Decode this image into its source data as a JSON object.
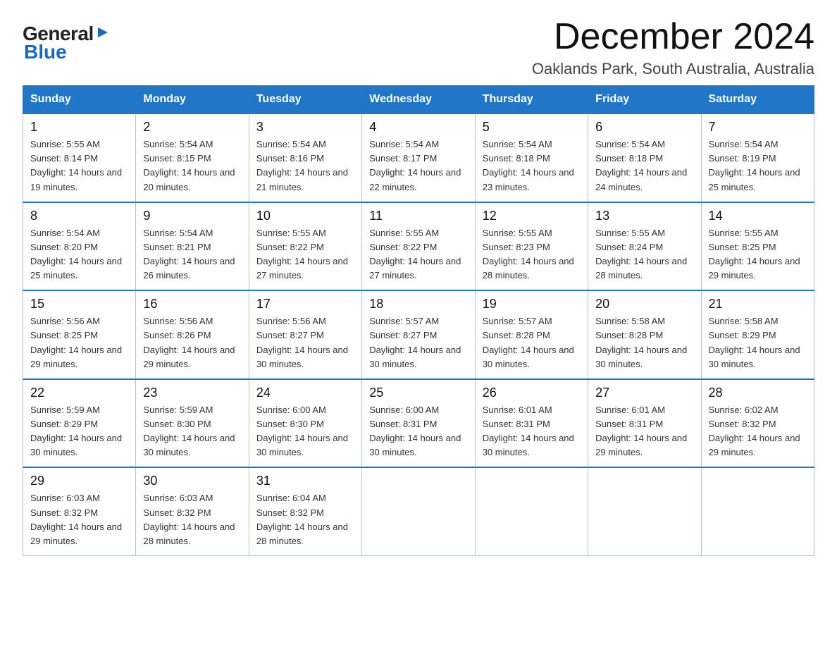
{
  "header": {
    "logo_general": "General",
    "logo_blue": "Blue",
    "month_title": "December 2024",
    "location": "Oaklands Park, South Australia, Australia"
  },
  "weekdays": [
    "Sunday",
    "Monday",
    "Tuesday",
    "Wednesday",
    "Thursday",
    "Friday",
    "Saturday"
  ],
  "weeks": [
    [
      {
        "day": "1",
        "sunrise": "5:55 AM",
        "sunset": "8:14 PM",
        "daylight": "14 hours and 19 minutes."
      },
      {
        "day": "2",
        "sunrise": "5:54 AM",
        "sunset": "8:15 PM",
        "daylight": "14 hours and 20 minutes."
      },
      {
        "day": "3",
        "sunrise": "5:54 AM",
        "sunset": "8:16 PM",
        "daylight": "14 hours and 21 minutes."
      },
      {
        "day": "4",
        "sunrise": "5:54 AM",
        "sunset": "8:17 PM",
        "daylight": "14 hours and 22 minutes."
      },
      {
        "day": "5",
        "sunrise": "5:54 AM",
        "sunset": "8:18 PM",
        "daylight": "14 hours and 23 minutes."
      },
      {
        "day": "6",
        "sunrise": "5:54 AM",
        "sunset": "8:18 PM",
        "daylight": "14 hours and 24 minutes."
      },
      {
        "day": "7",
        "sunrise": "5:54 AM",
        "sunset": "8:19 PM",
        "daylight": "14 hours and 25 minutes."
      }
    ],
    [
      {
        "day": "8",
        "sunrise": "5:54 AM",
        "sunset": "8:20 PM",
        "daylight": "14 hours and 25 minutes."
      },
      {
        "day": "9",
        "sunrise": "5:54 AM",
        "sunset": "8:21 PM",
        "daylight": "14 hours and 26 minutes."
      },
      {
        "day": "10",
        "sunrise": "5:55 AM",
        "sunset": "8:22 PM",
        "daylight": "14 hours and 27 minutes."
      },
      {
        "day": "11",
        "sunrise": "5:55 AM",
        "sunset": "8:22 PM",
        "daylight": "14 hours and 27 minutes."
      },
      {
        "day": "12",
        "sunrise": "5:55 AM",
        "sunset": "8:23 PM",
        "daylight": "14 hours and 28 minutes."
      },
      {
        "day": "13",
        "sunrise": "5:55 AM",
        "sunset": "8:24 PM",
        "daylight": "14 hours and 28 minutes."
      },
      {
        "day": "14",
        "sunrise": "5:55 AM",
        "sunset": "8:25 PM",
        "daylight": "14 hours and 29 minutes."
      }
    ],
    [
      {
        "day": "15",
        "sunrise": "5:56 AM",
        "sunset": "8:25 PM",
        "daylight": "14 hours and 29 minutes."
      },
      {
        "day": "16",
        "sunrise": "5:56 AM",
        "sunset": "8:26 PM",
        "daylight": "14 hours and 29 minutes."
      },
      {
        "day": "17",
        "sunrise": "5:56 AM",
        "sunset": "8:27 PM",
        "daylight": "14 hours and 30 minutes."
      },
      {
        "day": "18",
        "sunrise": "5:57 AM",
        "sunset": "8:27 PM",
        "daylight": "14 hours and 30 minutes."
      },
      {
        "day": "19",
        "sunrise": "5:57 AM",
        "sunset": "8:28 PM",
        "daylight": "14 hours and 30 minutes."
      },
      {
        "day": "20",
        "sunrise": "5:58 AM",
        "sunset": "8:28 PM",
        "daylight": "14 hours and 30 minutes."
      },
      {
        "day": "21",
        "sunrise": "5:58 AM",
        "sunset": "8:29 PM",
        "daylight": "14 hours and 30 minutes."
      }
    ],
    [
      {
        "day": "22",
        "sunrise": "5:59 AM",
        "sunset": "8:29 PM",
        "daylight": "14 hours and 30 minutes."
      },
      {
        "day": "23",
        "sunrise": "5:59 AM",
        "sunset": "8:30 PM",
        "daylight": "14 hours and 30 minutes."
      },
      {
        "day": "24",
        "sunrise": "6:00 AM",
        "sunset": "8:30 PM",
        "daylight": "14 hours and 30 minutes."
      },
      {
        "day": "25",
        "sunrise": "6:00 AM",
        "sunset": "8:31 PM",
        "daylight": "14 hours and 30 minutes."
      },
      {
        "day": "26",
        "sunrise": "6:01 AM",
        "sunset": "8:31 PM",
        "daylight": "14 hours and 30 minutes."
      },
      {
        "day": "27",
        "sunrise": "6:01 AM",
        "sunset": "8:31 PM",
        "daylight": "14 hours and 29 minutes."
      },
      {
        "day": "28",
        "sunrise": "6:02 AM",
        "sunset": "8:32 PM",
        "daylight": "14 hours and 29 minutes."
      }
    ],
    [
      {
        "day": "29",
        "sunrise": "6:03 AM",
        "sunset": "8:32 PM",
        "daylight": "14 hours and 29 minutes."
      },
      {
        "day": "30",
        "sunrise": "6:03 AM",
        "sunset": "8:32 PM",
        "daylight": "14 hours and 28 minutes."
      },
      {
        "day": "31",
        "sunrise": "6:04 AM",
        "sunset": "8:32 PM",
        "daylight": "14 hours and 28 minutes."
      },
      null,
      null,
      null,
      null
    ]
  ],
  "sunrise_label": "Sunrise:",
  "sunset_label": "Sunset:",
  "daylight_label": "Daylight:"
}
